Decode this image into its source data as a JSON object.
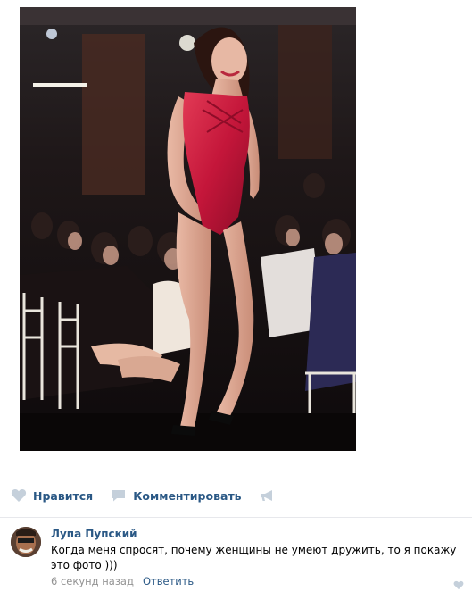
{
  "post": {
    "actions": {
      "like_label": "Нравится",
      "comment_label": "Комментировать",
      "like_icon": "heart-icon",
      "comment_icon": "speech-bubble-icon",
      "share_icon": "megaphone-icon"
    }
  },
  "comment": {
    "author": "Лупа Пупский",
    "text": "Когда меня спросят, почему женщины не умеют дружить, то я покажу это фото )))",
    "time": "6 секунд назад",
    "reply_label": "Ответить",
    "like_icon": "heart-icon"
  },
  "colors": {
    "link": "#2a5885",
    "muted": "#939393",
    "icon": "#c5d0db",
    "divider": "#e7e8ec"
  }
}
